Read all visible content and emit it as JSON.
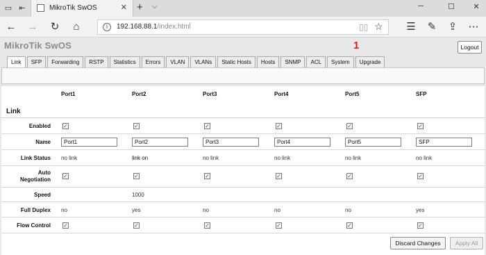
{
  "browser": {
    "tab_title": "MikroTik SwOS",
    "url_host": "192.168.88.1",
    "url_path": "/index.html",
    "icons": [
      "back-icon",
      "forward-icon",
      "refresh-icon",
      "home-icon",
      "info-icon",
      "reading-view-icon",
      "favorite-star-icon",
      "favorites-hub-icon",
      "pen-icon",
      "share-icon",
      "more-icon"
    ]
  },
  "app": {
    "logo": "MikroTik SwOS",
    "logout_label": "Logout",
    "annotation": "1",
    "tabs": [
      "Link",
      "SFP",
      "Forwarding",
      "RSTP",
      "Statistics",
      "Errors",
      "VLAN",
      "VLANs",
      "Static Hosts",
      "Hosts",
      "SNMP",
      "ACL",
      "System",
      "Upgrade"
    ],
    "active_tab": "Link"
  },
  "link": {
    "section_title": "Link",
    "ports": [
      "Port1",
      "Port2",
      "Port3",
      "Port4",
      "Port5",
      "SFP"
    ],
    "row_labels": {
      "enabled": "Enabled",
      "name": "Name",
      "link_status": "Link Status",
      "auto_negotiation_1": "Auto",
      "auto_negotiation_2": "Negotiation",
      "speed": "Speed",
      "full_duplex": "Full Duplex",
      "flow_control": "Flow Control"
    },
    "enabled": [
      true,
      true,
      true,
      true,
      true,
      true
    ],
    "names": [
      "Port1",
      "Port2",
      "Port3",
      "Port4",
      "Port5",
      "SFP"
    ],
    "link_status": [
      "no link",
      "link on",
      "no link",
      "no link",
      "no link",
      "no link"
    ],
    "auto_negotiation": [
      true,
      true,
      true,
      true,
      true,
      true
    ],
    "speed": [
      "",
      "1000",
      "",
      "",
      "",
      ""
    ],
    "full_duplex": [
      "no",
      "yes",
      "no",
      "no",
      "no",
      "yes"
    ],
    "flow_control": [
      true,
      true,
      true,
      true,
      true,
      true
    ]
  },
  "footer": {
    "discard_label": "Discard Changes",
    "apply_label": "Apply All"
  }
}
